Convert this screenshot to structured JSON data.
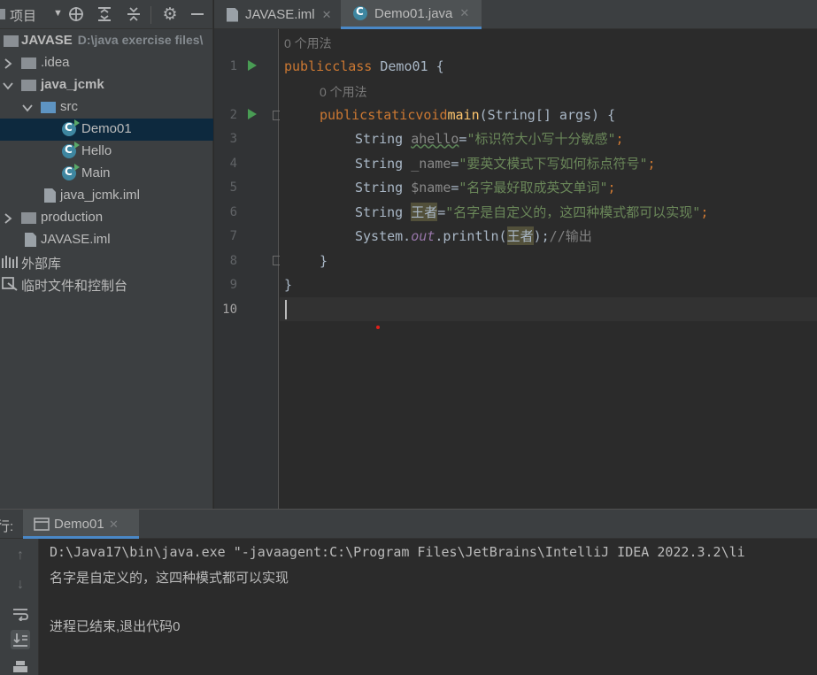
{
  "project_panel": {
    "title": "项目",
    "tree": [
      {
        "label": "JAVASE",
        "hint": "D:\\java exercise files\\"
      },
      {
        "label": ".idea"
      },
      {
        "label": "java_jcmk"
      },
      {
        "label": "src"
      },
      {
        "label": "Demo01"
      },
      {
        "label": "Hello"
      },
      {
        "label": "Main"
      },
      {
        "label": "java_jcmk.iml"
      },
      {
        "label": "production"
      },
      {
        "label": "JAVASE.iml"
      },
      {
        "label": "外部库"
      },
      {
        "label": "临时文件和控制台"
      }
    ]
  },
  "tabs": [
    {
      "label": "JAVASE.iml"
    },
    {
      "label": "Demo01.java"
    }
  ],
  "editor": {
    "usage_hint": "0 个用法",
    "line_numbers": [
      "1",
      "2",
      "3",
      "4",
      "5",
      "6",
      "7",
      "8",
      "9",
      "10"
    ],
    "code": {
      "l1_public": "public",
      "l1_class": "class",
      "l1_name": " Demo01 {",
      "l2_public": "public",
      "l2_static": "static",
      "l2_void": "void",
      "l2_main": "main",
      "l2_rest": "(String[] args) {",
      "l3_type": "String ",
      "l3_var": "ahello",
      "l3_eq": "=",
      "l3_str": "\"标识符大小写十分敏感\"",
      "l3_end": ";",
      "l4_type": "String ",
      "l4_var": "_name",
      "l4_eq": "=",
      "l4_str": "\"要英文模式下写如何标点符号\"",
      "l4_end": ";",
      "l5_type": "String ",
      "l5_var": "$name",
      "l5_eq": "=",
      "l5_str": "\"名字最好取成英文单词\"",
      "l5_end": ";",
      "l6_type": "String ",
      "l6_var": "王者",
      "l6_eq": "=",
      "l6_str": "\"名字是自定义的，这四种模式都可以实现\"",
      "l6_end": ";",
      "l7_sys": "System.",
      "l7_out": "out",
      "l7_println": ".println(",
      "l7_arg": "王者",
      "l7_close": ");",
      "l7_comment": "//输出",
      "l8": "}",
      "l9": "}"
    }
  },
  "run_panel": {
    "prefix": "行:",
    "tab_label": "Demo01",
    "console": {
      "command": "D:\\Java17\\bin\\java.exe \"-javaagent:C:\\Program Files\\JetBrains\\IntelliJ IDEA 2022.3.2\\li",
      "output": "名字是自定义的，这四种模式都可以实现",
      "exit": "进程已结束,退出代码0"
    }
  },
  "colors": {
    "keyword": "#cc7832",
    "string": "#6a8759",
    "method": "#ffc66d",
    "static_field": "#9876aa",
    "comment": "#808080",
    "selection": "#0d293e",
    "accent": "#4a88c7"
  }
}
